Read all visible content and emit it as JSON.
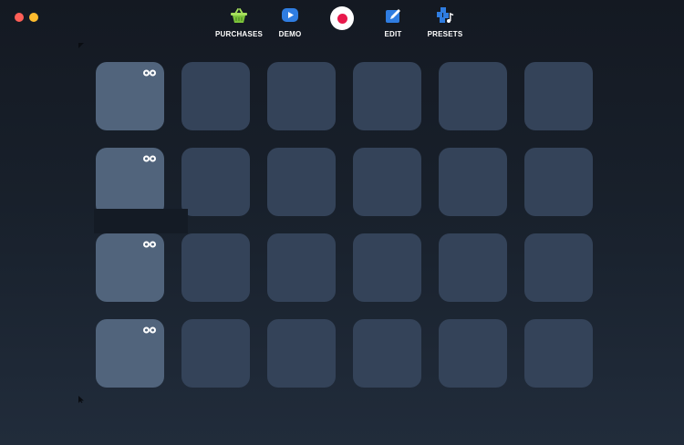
{
  "toolbar": {
    "purchases_label": "PURCHASES",
    "demo_label": "DEMO",
    "edit_label": "EDIT",
    "presets_label": "PRESETS"
  },
  "icons": {
    "purchases": "basket-icon",
    "demo": "play-icon",
    "record": "record-icon",
    "edit": "edit-pencil-icon",
    "presets": "presets-music-icon",
    "pad_loop": "infinity-loop-icon"
  },
  "colors": {
    "background": "#161b23",
    "pad_empty": "#344359",
    "pad_loaded": "#51647c",
    "record_accent": "#e8194b",
    "purchases_green": "#7cc33b",
    "demo_blue": "#2f7de1",
    "edit_blue": "#2f7de1",
    "presets_blue": "#2f7de1"
  },
  "pads": {
    "rows": 4,
    "columns": 6,
    "loaded_column": 1
  }
}
